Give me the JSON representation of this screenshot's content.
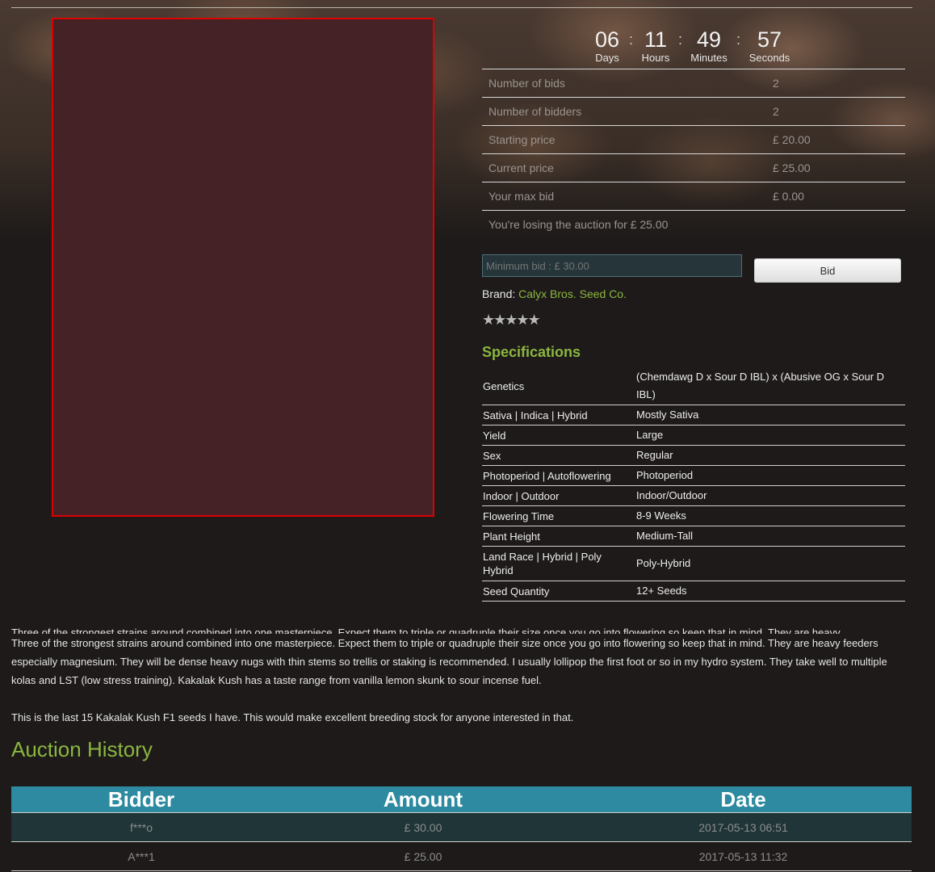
{
  "countdown": {
    "days": "06",
    "days_label": "Days",
    "hours": "11",
    "hours_label": "Hours",
    "minutes": "49",
    "minutes_label": "Minutes",
    "seconds": "57",
    "seconds_label": "Seconds",
    "separator": ":"
  },
  "stats": [
    {
      "label": "Number of bids",
      "value": "2"
    },
    {
      "label": "Number of bidders",
      "value": "2"
    },
    {
      "label": "Starting price",
      "value": "£ 20.00"
    },
    {
      "label": "Current price",
      "value": "£ 25.00"
    },
    {
      "label": "Your max bid",
      "value": "£ 0.00"
    }
  ],
  "status_message": "You're losing the auction for £ 25.00",
  "bid": {
    "placeholder": "Minimum bid : £ 30.00",
    "button_label": "Bid"
  },
  "brand": {
    "label": "Brand:",
    "name": "Calyx Bros. Seed Co."
  },
  "rating": {
    "stars": "★★★★★"
  },
  "specifications": {
    "title": "Specifications",
    "rows": [
      {
        "key": "Genetics",
        "value": "(Chemdawg D x Sour D IBL) x (Abusive OG x Sour D IBL)"
      },
      {
        "key": "Sativa | Indica | Hybrid",
        "value": "Mostly Sativa"
      },
      {
        "key": "Yield",
        "value": "Large"
      },
      {
        "key": "Sex",
        "value": "Regular"
      },
      {
        "key": "Photoperiod | Autoflowering",
        "value": "Photoperiod"
      },
      {
        "key": "Indoor | Outdoor",
        "value": "Indoor/Outdoor"
      },
      {
        "key": "Flowering Time",
        "value": "8-9 Weeks"
      },
      {
        "key": "Plant Height",
        "value": "Medium-Tall"
      },
      {
        "key": "Land Race | Hybrid | Poly Hybrid",
        "value": "Poly-Hybrid"
      },
      {
        "key": "Seed Quantity",
        "value": "12+ Seeds"
      }
    ]
  },
  "description": {
    "line0": "Three of the strongest strains around combined into one masterpiece. Expect them to triple or quadruple their size once you go into flowering so keep that in mind. They are heavy",
    "para1": "Three of the strongest strains around combined into one masterpiece. Expect them to triple or quadruple their size once you go into flowering so keep that in mind. They are heavy feeders especially magnesium. They will be dense heavy nugs with thin stems so trellis or staking is recommended. I usually lollipop the first foot or so in my hydro system. They take well to multiple kolas and LST (low stress training). Kakalak Kush has a taste range from vanilla lemon skunk to sour incense fuel.",
    "para2": "This is the last 15 Kakalak Kush F1 seeds I have.  This would make excellent breeding stock for anyone interested in that."
  },
  "history": {
    "title": "Auction History",
    "headers": {
      "bidder": "Bidder",
      "amount": "Amount",
      "date": "Date"
    },
    "rows": [
      {
        "bidder": "f***o",
        "amount": "£ 30.00",
        "date": "2017-05-13 06:51"
      },
      {
        "bidder": "A***1",
        "amount": "£ 25.00",
        "date": "2017-05-13 11:32"
      }
    ]
  }
}
